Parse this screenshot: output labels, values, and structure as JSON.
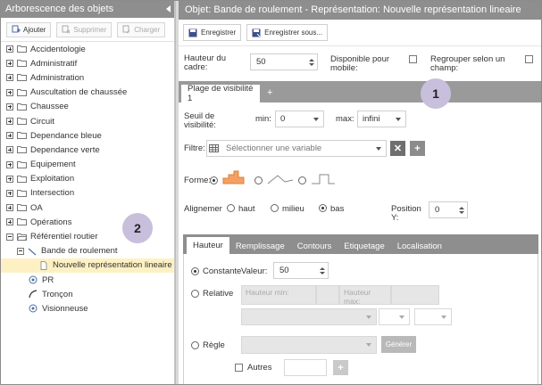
{
  "left": {
    "header": "Arborescence des objets",
    "toolbar": {
      "add": "Ajouter",
      "delete": "Supprimer",
      "load": "Charger"
    },
    "tree": [
      {
        "label": "Accidentologie"
      },
      {
        "label": "Administratif"
      },
      {
        "label": "Administration"
      },
      {
        "label": "Auscultation de chaussée"
      },
      {
        "label": "Chaussee"
      },
      {
        "label": "Circuit"
      },
      {
        "label": "Dependance bleue"
      },
      {
        "label": "Dependance verte"
      },
      {
        "label": "Equipement"
      },
      {
        "label": "Exploitation"
      },
      {
        "label": "Intersection"
      },
      {
        "label": "OA"
      },
      {
        "label": "Opérations"
      }
    ],
    "expanded": {
      "root": "Référentiel routier",
      "child": "Bande de roulement",
      "selected": "Nouvelle représentation lineaire",
      "others": [
        "PR",
        "Tronçon",
        "Visionneuse"
      ]
    }
  },
  "right": {
    "header": "Objet: Bande de roulement - Représentation: Nouvelle représentation lineaire",
    "toolbar": {
      "save": "Enregistrer",
      "save_as": "Enregistrer sous..."
    },
    "frame_height_label": "Hauteur du cadre:",
    "frame_height_value": "50",
    "mobile_label": "Disponible pour mobile:",
    "group_label": "Regrouper selon un champ:",
    "tab_label": "Plage de visibilité 1",
    "tab_add": "+",
    "visibility": {
      "label": "Seuil de visibilité:",
      "min_label": "min:",
      "min_value": "0",
      "max_label": "max:",
      "max_value": "infini"
    },
    "filter": {
      "label": "Filtre:",
      "placeholder": "Sélectionner une variable"
    },
    "shape_label": "Forme:",
    "align": {
      "label": "Alignemer",
      "top": "haut",
      "middle": "milieu",
      "bottom": "bas",
      "pos_label": "Position Y:",
      "pos_value": "0"
    },
    "subtabs": [
      "Hauteur",
      "Remplissage",
      "Contours",
      "Etiquetage",
      "Localisation"
    ],
    "height": {
      "constant": "Constante",
      "value_label": "Valeur:",
      "value": "50",
      "relative": "Relative",
      "height_min": "Hauteur min:",
      "height_max": "Hauteur max:",
      "rule": "Règle",
      "generate": "Générer",
      "others": "Autres"
    }
  },
  "badges": [
    "1",
    "2"
  ],
  "colors": {
    "header": "#8e8e8e",
    "selection": "#fdf1c4",
    "badge": "#c8bfdc"
  }
}
